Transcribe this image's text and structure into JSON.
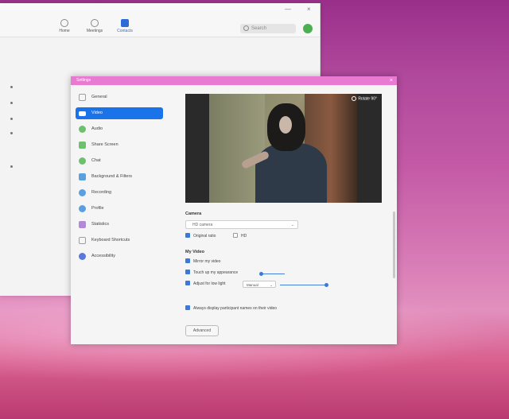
{
  "main_window": {
    "nav": [
      {
        "label": "Home",
        "icon": "home-icon",
        "active": false
      },
      {
        "label": "Meetings",
        "icon": "clock-icon",
        "active": false
      },
      {
        "label": "Contacts",
        "icon": "contacts-icon",
        "active": true
      }
    ],
    "search": {
      "placeholder": "Search"
    },
    "window_controls": {
      "minimize": "—",
      "close": "×"
    }
  },
  "settings": {
    "title": "Settings",
    "close_glyph": "×",
    "sidebar": [
      {
        "label": "General",
        "icon": "gear-icon",
        "color": "#9e9e9e",
        "active": false
      },
      {
        "label": "Video",
        "icon": "video-icon",
        "color": "#ffffff",
        "active": true
      },
      {
        "label": "Audio",
        "icon": "headphones-icon",
        "color": "#6ec06e",
        "active": false
      },
      {
        "label": "Share Screen",
        "icon": "share-screen-icon",
        "color": "#6ec06e",
        "active": false
      },
      {
        "label": "Chat",
        "icon": "chat-icon",
        "color": "#6ec06e",
        "active": false
      },
      {
        "label": "Background & Filters",
        "icon": "background-icon",
        "color": "#5aa0e0",
        "active": false
      },
      {
        "label": "Recording",
        "icon": "recording-icon",
        "color": "#5aa0e0",
        "active": false
      },
      {
        "label": "Profile",
        "icon": "profile-icon",
        "color": "#5aa0e0",
        "active": false
      },
      {
        "label": "Statistics",
        "icon": "statistics-icon",
        "color": "#b388d9",
        "active": false
      },
      {
        "label": "Keyboard Shortcuts",
        "icon": "keyboard-icon",
        "color": "#9e9e9e",
        "active": false
      },
      {
        "label": "Accessibility",
        "icon": "accessibility-icon",
        "color": "#5a78d9",
        "active": false
      }
    ],
    "video": {
      "preview_label": "Rotate 90°",
      "camera_label": "Camera",
      "camera_value": "HD camera",
      "original_ratio": {
        "label": "Original ratio",
        "checked": true
      },
      "hd": {
        "label": "HD",
        "checked": false
      },
      "my_video_label": "My Video",
      "mirror": {
        "label": "Mirror my video",
        "checked": true
      },
      "touch_up": {
        "label": "Touch up my appearance",
        "checked": true
      },
      "low_light": {
        "label": "Adjust for low light",
        "checked": true,
        "mode": "Manual"
      },
      "always_display": {
        "label": "Always display participant names on their video",
        "checked": true
      },
      "advanced_label": "Advanced"
    }
  }
}
